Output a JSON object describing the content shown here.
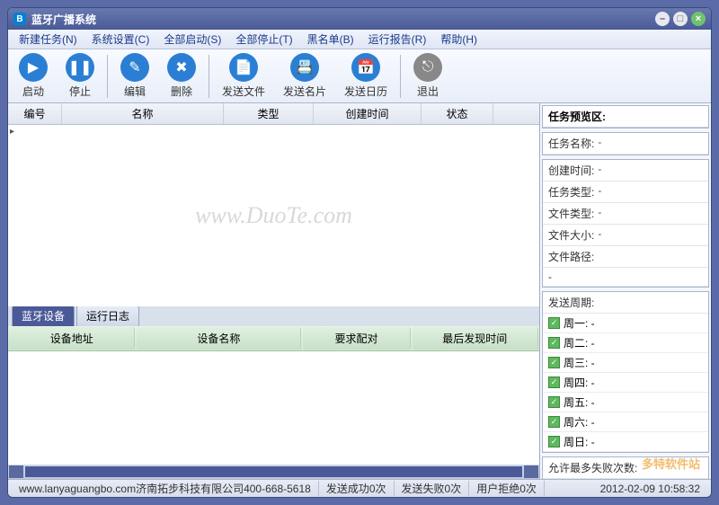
{
  "window": {
    "title": "蓝牙广播系统"
  },
  "menu": [
    "新建任务(N)",
    "系统设置(C)",
    "全部启动(S)",
    "全部停止(T)",
    "黑名单(B)",
    "运行报告(R)",
    "帮助(H)"
  ],
  "toolbar": {
    "start": "启动",
    "stop": "停止",
    "edit": "编辑",
    "delete": "删除",
    "sendfile": "发送文件",
    "sendcard": "发送名片",
    "sendcal": "发送日历",
    "exit": "退出"
  },
  "task_table": {
    "cols": [
      "编号",
      "名称",
      "类型",
      "创建时间",
      "状态"
    ]
  },
  "tabs": {
    "devices": "蓝牙设备",
    "log": "运行日志"
  },
  "device_table": {
    "cols": [
      "设备地址",
      "设备名称",
      "要求配对",
      "最后发现时间"
    ]
  },
  "preview": {
    "title": "任务预览区:",
    "fields": {
      "name": {
        "label": "任务名称:",
        "value": "-"
      },
      "ctime": {
        "label": "创建时间:",
        "value": "-"
      },
      "ttype": {
        "label": "任务类型:",
        "value": "-"
      },
      "ftype": {
        "label": "文件类型:",
        "value": "-"
      },
      "fsize": {
        "label": "文件大小:",
        "value": "-"
      },
      "fpath": {
        "label": "文件路径:",
        "value": ""
      },
      "fpath2": {
        "label": "-",
        "value": ""
      }
    },
    "schedule_title": "发送周期:",
    "days": [
      "周一: -",
      "周二: -",
      "周三: -",
      "周四: -",
      "周五: -",
      "周六: -",
      "周日: -"
    ],
    "max_fail": "允许最多失败次数:"
  },
  "status": {
    "url": "www.lanyaguangbo.com济南拓步科技有限公司400-668-5618",
    "succ": "发送成功0次",
    "fail": "发送失败0次",
    "reject": "用户拒绝0次",
    "time": "2012-02-09 10:58:32"
  },
  "watermark": "www.DuoTe.com",
  "corner_wm": "多特软件站"
}
